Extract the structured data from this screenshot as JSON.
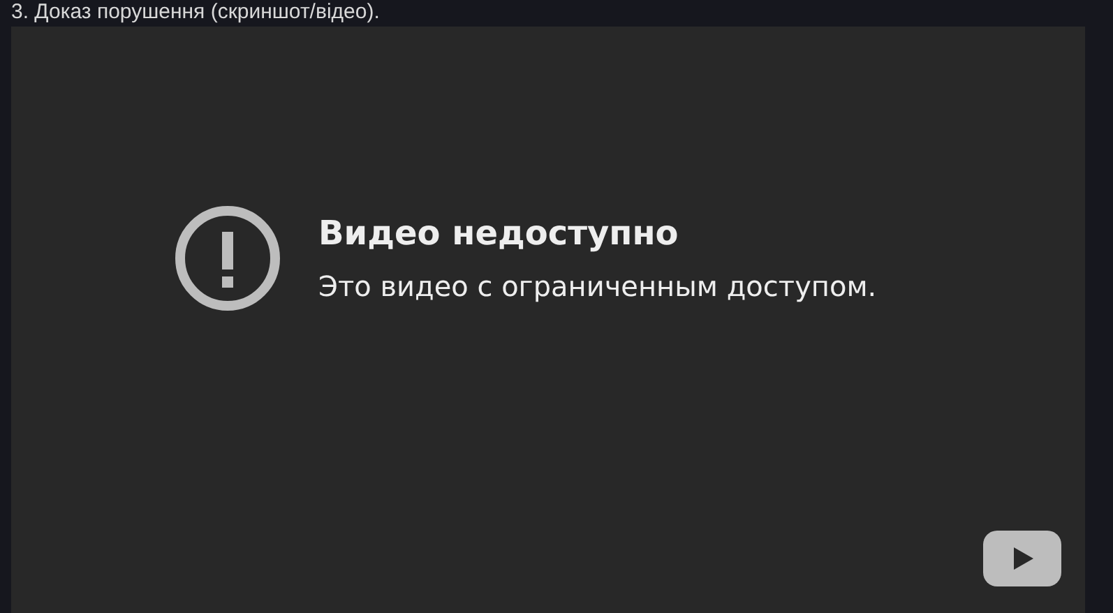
{
  "caption": "3. Доказ порушення (скриншот/відео).",
  "video": {
    "title": "Видео недоступно",
    "message": "Это видео с ограниченным доступом."
  }
}
